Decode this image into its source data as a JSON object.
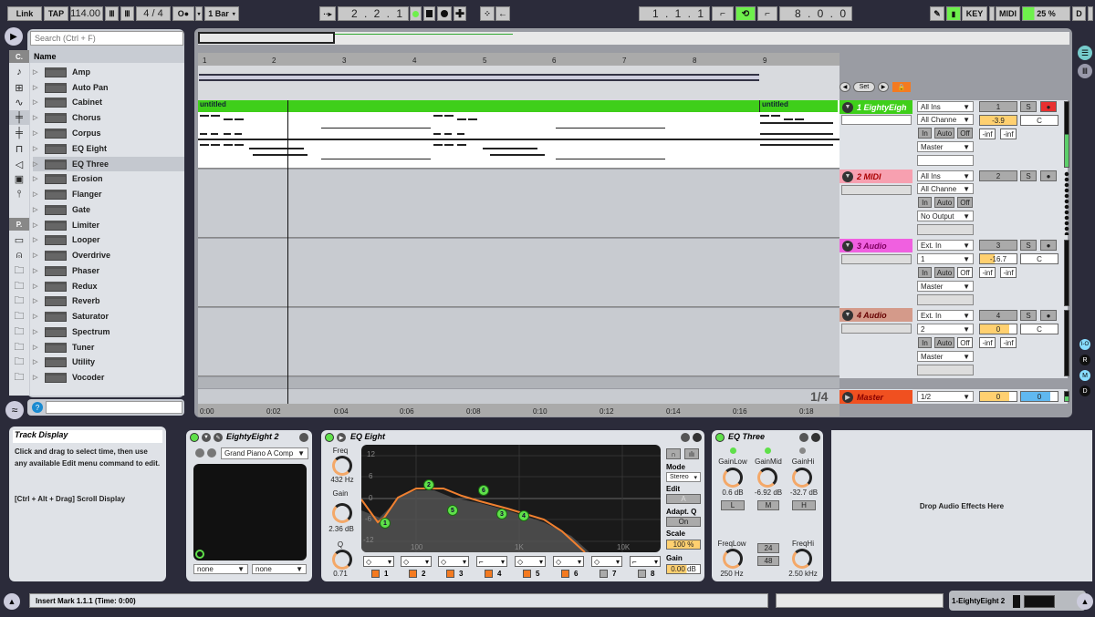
{
  "transport": {
    "link": "Link",
    "tap": "TAP",
    "tempo": "114.00",
    "signature": "4 / 4",
    "metronome": "O●",
    "quantize": "1 Bar",
    "position": "2 . 2 . 1",
    "loop_start": "1 . 1 . 1",
    "loop_length": "8 . 0 . 0",
    "key": "KEY",
    "midi": "MIDI",
    "cpu": "25 %",
    "d": "D",
    "cpu_fraction": 0.25
  },
  "browser": {
    "search_placeholder": "Search (Ctrl + F)",
    "header": "Name",
    "cat_c": "C.",
    "cat_p": "P.",
    "items": [
      "Amp",
      "Auto Pan",
      "Cabinet",
      "Chorus",
      "Corpus",
      "EQ Eight",
      "EQ Three",
      "Erosion",
      "Flanger",
      "Gate",
      "Limiter",
      "Looper",
      "Overdrive",
      "Phaser",
      "Redux",
      "Reverb",
      "Saturator",
      "Spectrum",
      "Tuner",
      "Utility",
      "Vocoder"
    ],
    "selected": "EQ Three"
  },
  "arrangement": {
    "ruler": [
      "1",
      "2",
      "3",
      "4",
      "5",
      "6",
      "7",
      "8",
      "9"
    ],
    "times": [
      "0:00",
      "0:02",
      "0:04",
      "0:06",
      "0:08",
      "0:10",
      "0:12",
      "0:14",
      "0:16",
      "0:18"
    ],
    "clip1": "untitled",
    "clip2": "untitled",
    "zoom_label": "1/4",
    "set_label": "Set"
  },
  "tracks": [
    {
      "name": "1 EightyEigh",
      "color": "#3fcf1a",
      "input": "All Ins",
      "channel": "All Channe",
      "monitor": [
        "In",
        "Auto",
        "Off"
      ],
      "output": "Master",
      "number": "1",
      "volume": "-3.9",
      "pan": "C",
      "peak1": "-inf",
      "peak2": "-inf",
      "num_on": true
    },
    {
      "name": "2 MIDI",
      "color": "#f7a0b0",
      "input": "All Ins",
      "channel": "All Channe",
      "monitor": [
        "In",
        "Auto",
        "Off"
      ],
      "output": "No Output",
      "number": "2",
      "num_on": true
    },
    {
      "name": "3 Audio",
      "color": "#f060e0",
      "input": "Ext. In",
      "channel": "1",
      "monitor": [
        "In",
        "Auto",
        "Off"
      ],
      "output": "Master",
      "number": "3",
      "volume": "-16.7",
      "pan": "C",
      "peak1": "-inf",
      "peak2": "-inf",
      "num_on": false
    },
    {
      "name": "4 Audio",
      "color": "#d49a8a",
      "input": "Ext. In",
      "channel": "2",
      "monitor": [
        "In",
        "Auto",
        "Off"
      ],
      "output": "Master",
      "number": "4",
      "volume": "0",
      "pan": "C",
      "peak1": "-inf",
      "peak2": "-inf",
      "num_on": true
    }
  ],
  "master": {
    "name": "Master",
    "output": "1/2",
    "volume": "0",
    "pan": "0"
  },
  "solo_label": "S",
  "info": {
    "title": "Track Display",
    "line1": "Click and drag to select time, then use any available Edit menu command to edit.",
    "line2": "[Ctrl + Alt + Drag] Scroll Display"
  },
  "instrument": {
    "title": "EightyEight 2",
    "preset": "Grand Piano A Comp",
    "sel1": "none",
    "sel2": "none"
  },
  "eq8": {
    "title": "EQ Eight",
    "freq_label": "Freq",
    "freq": "432 Hz",
    "gain_label": "Gain",
    "gain": "2.36 dB",
    "q_label": "Q",
    "q": "0.71",
    "mode_label": "Mode",
    "mode": "Stereo",
    "edit_label": "Edit",
    "edit": "A",
    "adaptq_label": "Adapt. Q",
    "adaptq": "On",
    "scale_label": "Scale",
    "scale": "100 %",
    "outgain_label": "Gain",
    "outgain": "0.00 dB",
    "db_ticks": [
      "12",
      "6",
      "0",
      "-6",
      "-12"
    ],
    "freq_ticks": [
      "100",
      "1K",
      "10K"
    ],
    "bands": [
      "1",
      "2",
      "3",
      "4",
      "5",
      "6",
      "7",
      "8"
    ]
  },
  "eq3": {
    "title": "EQ Three",
    "gainlow_label": "GainLow",
    "gainlow": "0.6 dB",
    "gainmid_label": "GainMid",
    "gainmid": "-6.92 dB",
    "gainhi_label": "GainHi",
    "gainhi": "-32.7 dB",
    "l": "L",
    "m": "M",
    "h": "H",
    "freqlow_label": "FreqLow",
    "freqlow": "250 Hz",
    "freqhi_label": "FreqHi",
    "freqhi": "2.50 kHz",
    "slope24": "24",
    "slope48": "48"
  },
  "drop_label": "Drop Audio Effects Here",
  "status": {
    "text": "Insert Mark 1.1.1 (Time: 0:00)",
    "track": "1-EightyEight 2"
  },
  "side_letters": [
    "I-O",
    "R",
    "M",
    "D"
  ]
}
